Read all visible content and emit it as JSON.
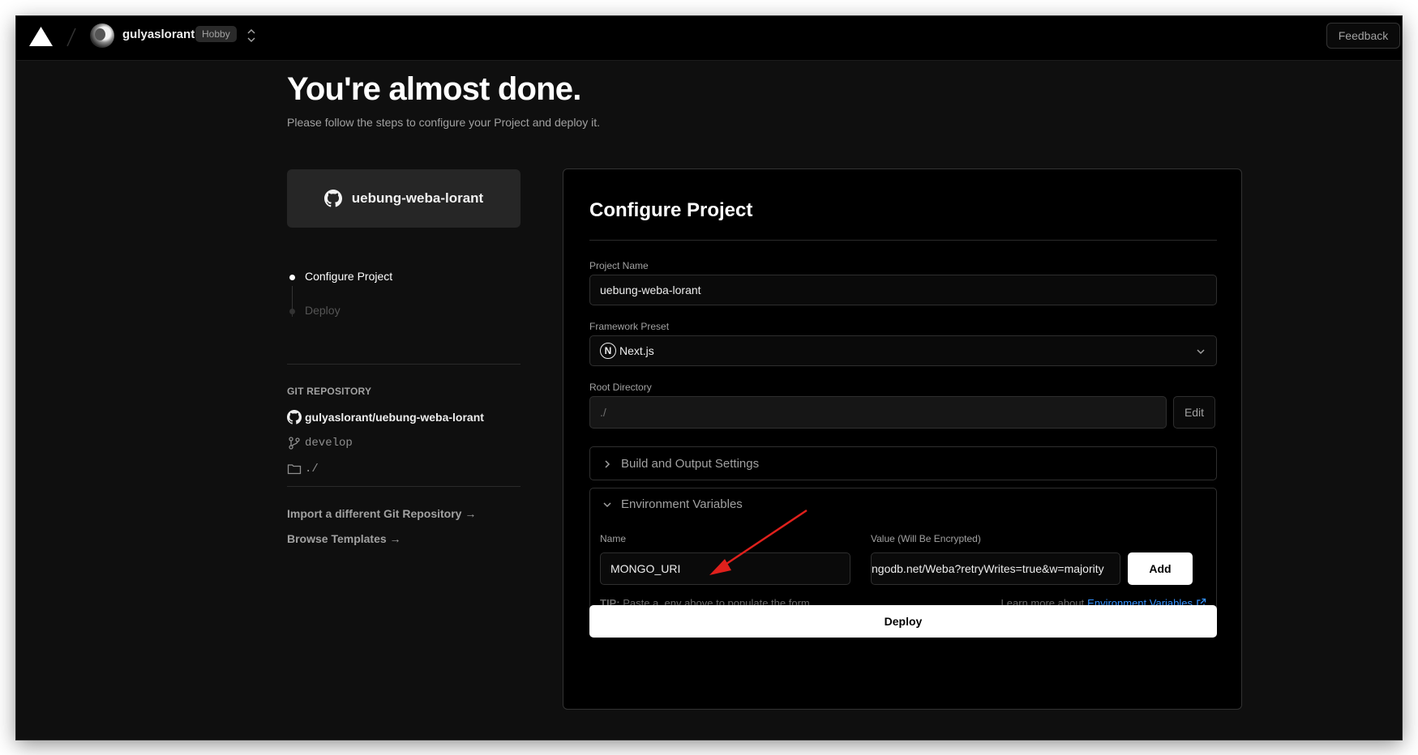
{
  "topbar": {
    "username": "gulyaslorant",
    "plan_badge": "Hobby",
    "feedback_label": "Feedback"
  },
  "header": {
    "title": "You're almost done.",
    "subtitle": "Please follow the steps to configure your Project and deploy it."
  },
  "sidebar": {
    "repo_card_name": "uebung-weba-lorant",
    "steps": [
      {
        "label": "Configure Project",
        "state": "active"
      },
      {
        "label": "Deploy",
        "state": "pending"
      }
    ],
    "git": {
      "heading": "GIT REPOSITORY",
      "repository": "gulyaslorant/uebung-weba-lorant",
      "branch": "develop",
      "directory": "./"
    },
    "links": {
      "import": "Import a different Git Repository →",
      "templates": "Browse Templates →"
    }
  },
  "config": {
    "title": "Configure Project",
    "project_name_label": "Project Name",
    "project_name_value": "uebung-weba-lorant",
    "framework_label": "Framework Preset",
    "framework_value": "Next.js",
    "framework_icon_letter": "N",
    "root_dir_label": "Root Directory",
    "root_dir_value": "./",
    "edit_label": "Edit",
    "build_settings_label": "Build and Output Settings",
    "env": {
      "section_label": "Environment Variables",
      "name_label": "Name",
      "name_value": "MONGO_URI",
      "value_label": "Value (Will Be Encrypted)",
      "value_value": "ngodb.net/Weba?retryWrites=true&w=majority",
      "add_label": "Add",
      "tip_prefix": "TIP:",
      "tip_text": "Paste a .env above to populate the form",
      "learn_more_prefix": "Learn more about",
      "learn_more_link": "Environment Variables"
    },
    "deploy_label": "Deploy"
  },
  "colors": {
    "background": "#0f0f0f",
    "topbar": "#000000",
    "link_blue": "#3291ff",
    "annotation_arrow": "#e0201c"
  }
}
